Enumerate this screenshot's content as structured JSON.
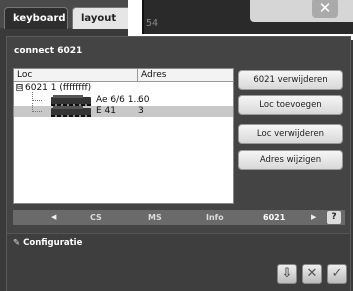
{
  "tabs": [
    "keyboard",
    "layout"
  ],
  "overlay": {
    "glyph": "54",
    "close_icon": "close-icon"
  },
  "dialog": {
    "title": "connect 6021"
  },
  "list": {
    "columns": [
      "Loc",
      "Adres"
    ],
    "root": {
      "toggle": "⊟",
      "label": "6021 1 (ffffffff)"
    },
    "rows": [
      {
        "name": "Ae 6/6 1...",
        "address": "60"
      },
      {
        "name": "E 41",
        "address": "3",
        "selected": true
      }
    ]
  },
  "buttons": [
    "6021 verwijderen",
    "Loc toevoegen",
    "Loc verwijderen",
    "Adres wijzigen"
  ],
  "nav": {
    "left_arrow": "◀",
    "items": [
      "CS",
      "MS",
      "Info",
      "6021"
    ],
    "active": "6021",
    "right_arrow": "▶",
    "help": "?"
  },
  "config": {
    "label": "Configuratie"
  },
  "actions": [
    "install-icon",
    "cancel-icon",
    "confirm-icon"
  ]
}
